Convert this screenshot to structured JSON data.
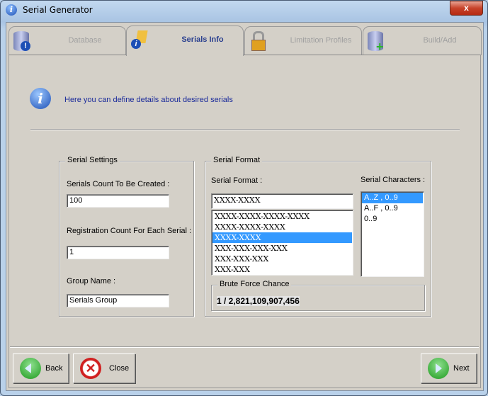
{
  "window": {
    "title": "Serial Generator",
    "close": "x"
  },
  "tabs": [
    {
      "label": "Database"
    },
    {
      "label": "Serials Info"
    },
    {
      "label": "Limitation Profiles"
    },
    {
      "label": "Build/Add"
    }
  ],
  "info_text": "Here you can define details about desired serials",
  "serial_settings": {
    "title": "Serial Settings",
    "count_label": "Serials Count To Be Created :",
    "count_value": "100",
    "reg_label": "Registration Count For Each Serial :",
    "reg_value": "1",
    "group_label": "Group Name :",
    "group_value": "Serials Group"
  },
  "serial_format": {
    "title": "Serial Format",
    "format_label": "Serial Format :",
    "format_value": "XXXX-XXXX",
    "formats": [
      "XXXX-XXXX-XXXX-XXXX",
      "XXXX-XXXX-XXXX",
      "XXXX-XXXX",
      "XXX-XXX-XXX-XXX",
      "XXX-XXX-XXX",
      "XXX-XXX"
    ],
    "selected_format": 2,
    "chars_label": "Serial Characters :",
    "chars": [
      "A..Z , 0..9",
      "A..F , 0..9",
      "0..9"
    ],
    "brute_title": "Brute Force Chance",
    "brute_value": "1 / 2,821,109,907,456"
  },
  "buttons": {
    "back": "Back",
    "close": "Close",
    "next": "Next"
  },
  "colors": {
    "accent": "#3399ff",
    "face": "#d4d0c8"
  }
}
